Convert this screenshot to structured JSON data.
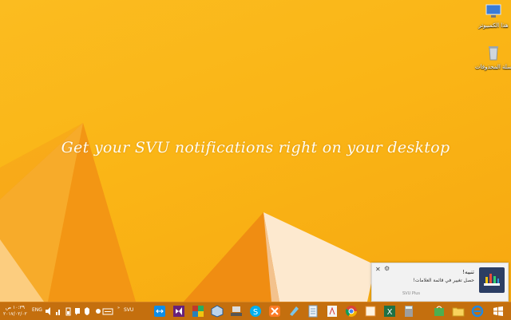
{
  "desktop": {
    "tagline": "Get your SVU notifications right on your desktop",
    "icons": [
      {
        "name": "this-pc",
        "label": "هذا الكمبيوتر"
      },
      {
        "name": "recycle-bin",
        "label": "سلة المحذوفات"
      }
    ],
    "colors": {
      "background": "#fab516",
      "facet_light": "#fde9cf",
      "facet_dark": "#f08a0c"
    }
  },
  "toast": {
    "title": "تنبيه!",
    "body": "حصل تغيير في قائمة العلامات!",
    "source": "SVU Plus",
    "close_glyph": "✕",
    "settings_glyph": "⚙"
  },
  "taskbar": {
    "clock_time": "١٠:٣٩ ص",
    "clock_date": "٢٠١٧/٠٢/٠٢",
    "language": "ENG",
    "svu_label": "SVU",
    "color": "#c46f0e",
    "apps": [
      "file-explorer-icon",
      "store-icon",
      "ie-icon",
      "calc-icon",
      "excel-icon",
      "app-icon",
      "chrome-icon",
      "acrobat-icon",
      "notepad-icon",
      "paint-icon",
      "xampp-icon",
      "skype-icon",
      "network-icon",
      "virtualbox-icon",
      "winrar-icon",
      "visual-studio-icon",
      "teamviewer-icon"
    ]
  }
}
